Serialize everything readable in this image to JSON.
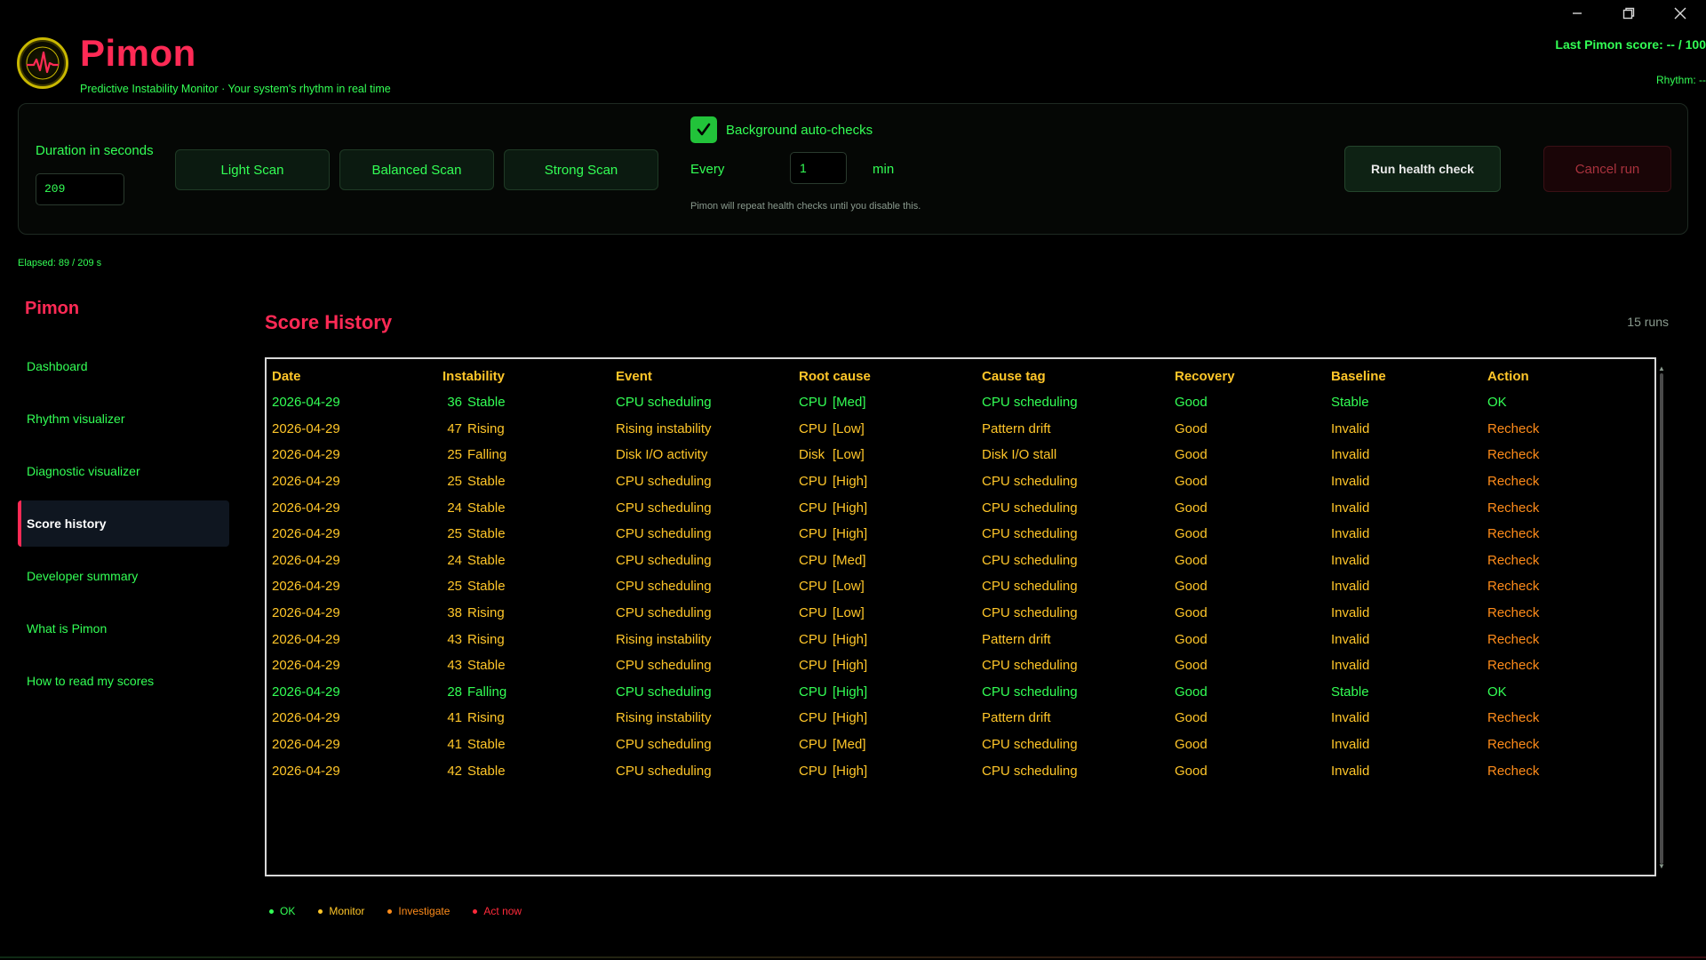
{
  "window": {
    "minimize_icon": "minimize-icon",
    "restore_icon": "restore-icon",
    "close_icon": "close-icon"
  },
  "header": {
    "title": "Pimon",
    "subtitle": "Predictive Instability Monitor · Your system's rhythm in real time",
    "last_score": "Last Pimon score: -- / 100",
    "rhythm": "Rhythm: --"
  },
  "controls": {
    "duration_label": "Duration in seconds",
    "duration_value": "209",
    "light_scan": "Light Scan",
    "balanced_scan": "Balanced Scan",
    "strong_scan": "Strong Scan",
    "background_checks_label": "Background auto-checks",
    "background_checks_checked": true,
    "every_label": "Every",
    "every_value": "1",
    "min_label": "min",
    "repeat_note": "Pimon will repeat health checks until you disable this.",
    "run_button": "Run health check",
    "cancel_button": "Cancel run",
    "elapsed": "Elapsed: 89 / 209 s"
  },
  "sidebar": {
    "title": "Pimon",
    "items": [
      {
        "label": "Dashboard",
        "active": false
      },
      {
        "label": "Rhythm visualizer",
        "active": false
      },
      {
        "label": "Diagnostic visualizer",
        "active": false
      },
      {
        "label": "Score history",
        "active": true
      },
      {
        "label": "Developer summary",
        "active": false
      },
      {
        "label": "What is Pimon",
        "active": false
      },
      {
        "label": "How to read my scores",
        "active": false
      }
    ]
  },
  "main": {
    "title": "Score History",
    "runs_count": "15 runs",
    "columns": [
      "Date",
      "Instability",
      "Event",
      "Root cause",
      "Cause tag",
      "Recovery",
      "Baseline",
      "Action"
    ],
    "rows": [
      {
        "date": "2026-04-29",
        "score": "36",
        "trend": "Stable",
        "event": "CPU scheduling",
        "rc_res": "CPU",
        "rc_lvl": "[Med]",
        "tag": "CPU scheduling",
        "recovery": "Good",
        "baseline": "Stable",
        "action": "OK",
        "status": "ok"
      },
      {
        "date": "2026-04-29",
        "score": "47",
        "trend": "Rising",
        "event": "Rising instability",
        "rc_res": "CPU",
        "rc_lvl": "[Low]",
        "tag": "Pattern drift",
        "recovery": "Good",
        "baseline": "Invalid",
        "action": "Recheck",
        "status": "warn"
      },
      {
        "date": "2026-04-29",
        "score": "25",
        "trend": "Falling",
        "event": "Disk I/O activity",
        "rc_res": "Disk",
        "rc_lvl": "[Low]",
        "tag": "Disk I/O stall",
        "recovery": "Good",
        "baseline": "Invalid",
        "action": "Recheck",
        "status": "warn"
      },
      {
        "date": "2026-04-29",
        "score": "25",
        "trend": "Stable",
        "event": "CPU scheduling",
        "rc_res": "CPU",
        "rc_lvl": "[High]",
        "tag": "CPU scheduling",
        "recovery": "Good",
        "baseline": "Invalid",
        "action": "Recheck",
        "status": "warn"
      },
      {
        "date": "2026-04-29",
        "score": "24",
        "trend": "Stable",
        "event": "CPU scheduling",
        "rc_res": "CPU",
        "rc_lvl": "[High]",
        "tag": "CPU scheduling",
        "recovery": "Good",
        "baseline": "Invalid",
        "action": "Recheck",
        "status": "warn"
      },
      {
        "date": "2026-04-29",
        "score": "25",
        "trend": "Stable",
        "event": "CPU scheduling",
        "rc_res": "CPU",
        "rc_lvl": "[High]",
        "tag": "CPU scheduling",
        "recovery": "Good",
        "baseline": "Invalid",
        "action": "Recheck",
        "status": "warn"
      },
      {
        "date": "2026-04-29",
        "score": "24",
        "trend": "Stable",
        "event": "CPU scheduling",
        "rc_res": "CPU",
        "rc_lvl": "[Med]",
        "tag": "CPU scheduling",
        "recovery": "Good",
        "baseline": "Invalid",
        "action": "Recheck",
        "status": "warn"
      },
      {
        "date": "2026-04-29",
        "score": "25",
        "trend": "Stable",
        "event": "CPU scheduling",
        "rc_res": "CPU",
        "rc_lvl": "[Low]",
        "tag": "CPU scheduling",
        "recovery": "Good",
        "baseline": "Invalid",
        "action": "Recheck",
        "status": "warn"
      },
      {
        "date": "2026-04-29",
        "score": "38",
        "trend": "Rising",
        "event": "CPU scheduling",
        "rc_res": "CPU",
        "rc_lvl": "[Low]",
        "tag": "CPU scheduling",
        "recovery": "Good",
        "baseline": "Invalid",
        "action": "Recheck",
        "status": "warn"
      },
      {
        "date": "2026-04-29",
        "score": "43",
        "trend": "Rising",
        "event": "Rising instability",
        "rc_res": "CPU",
        "rc_lvl": "[High]",
        "tag": "Pattern drift",
        "recovery": "Good",
        "baseline": "Invalid",
        "action": "Recheck",
        "status": "warn"
      },
      {
        "date": "2026-04-29",
        "score": "43",
        "trend": "Stable",
        "event": "CPU scheduling",
        "rc_res": "CPU",
        "rc_lvl": "[High]",
        "tag": "CPU scheduling",
        "recovery": "Good",
        "baseline": "Invalid",
        "action": "Recheck",
        "status": "warn"
      },
      {
        "date": "2026-04-29",
        "score": "28",
        "trend": "Falling",
        "event": "CPU scheduling",
        "rc_res": "CPU",
        "rc_lvl": "[High]",
        "tag": "CPU scheduling",
        "recovery": "Good",
        "baseline": "Stable",
        "action": "OK",
        "status": "ok"
      },
      {
        "date": "2026-04-29",
        "score": "41",
        "trend": "Rising",
        "event": "Rising instability",
        "rc_res": "CPU",
        "rc_lvl": "[High]",
        "tag": "Pattern drift",
        "recovery": "Good",
        "baseline": "Invalid",
        "action": "Recheck",
        "status": "warn"
      },
      {
        "date": "2026-04-29",
        "score": "41",
        "trend": "Stable",
        "event": "CPU scheduling",
        "rc_res": "CPU",
        "rc_lvl": "[Med]",
        "tag": "CPU scheduling",
        "recovery": "Good",
        "baseline": "Invalid",
        "action": "Recheck",
        "status": "warn"
      },
      {
        "date": "2026-04-29",
        "score": "42",
        "trend": "Stable",
        "event": "CPU scheduling",
        "rc_res": "CPU",
        "rc_lvl": "[High]",
        "tag": "CPU scheduling",
        "recovery": "Good",
        "baseline": "Invalid",
        "action": "Recheck",
        "status": "warn"
      }
    ]
  },
  "legend": [
    {
      "label": "OK",
      "color": "#33ff55"
    },
    {
      "label": "Monitor",
      "color": "#ffc629"
    },
    {
      "label": "Investigate",
      "color": "#ff8c1a"
    },
    {
      "label": "Act now",
      "color": "#ff2a3a"
    }
  ],
  "colors": {
    "accent": "#ff2a55",
    "ok": "#33ff55",
    "monitor": "#ffc629",
    "investigate": "#ff8c1a"
  }
}
